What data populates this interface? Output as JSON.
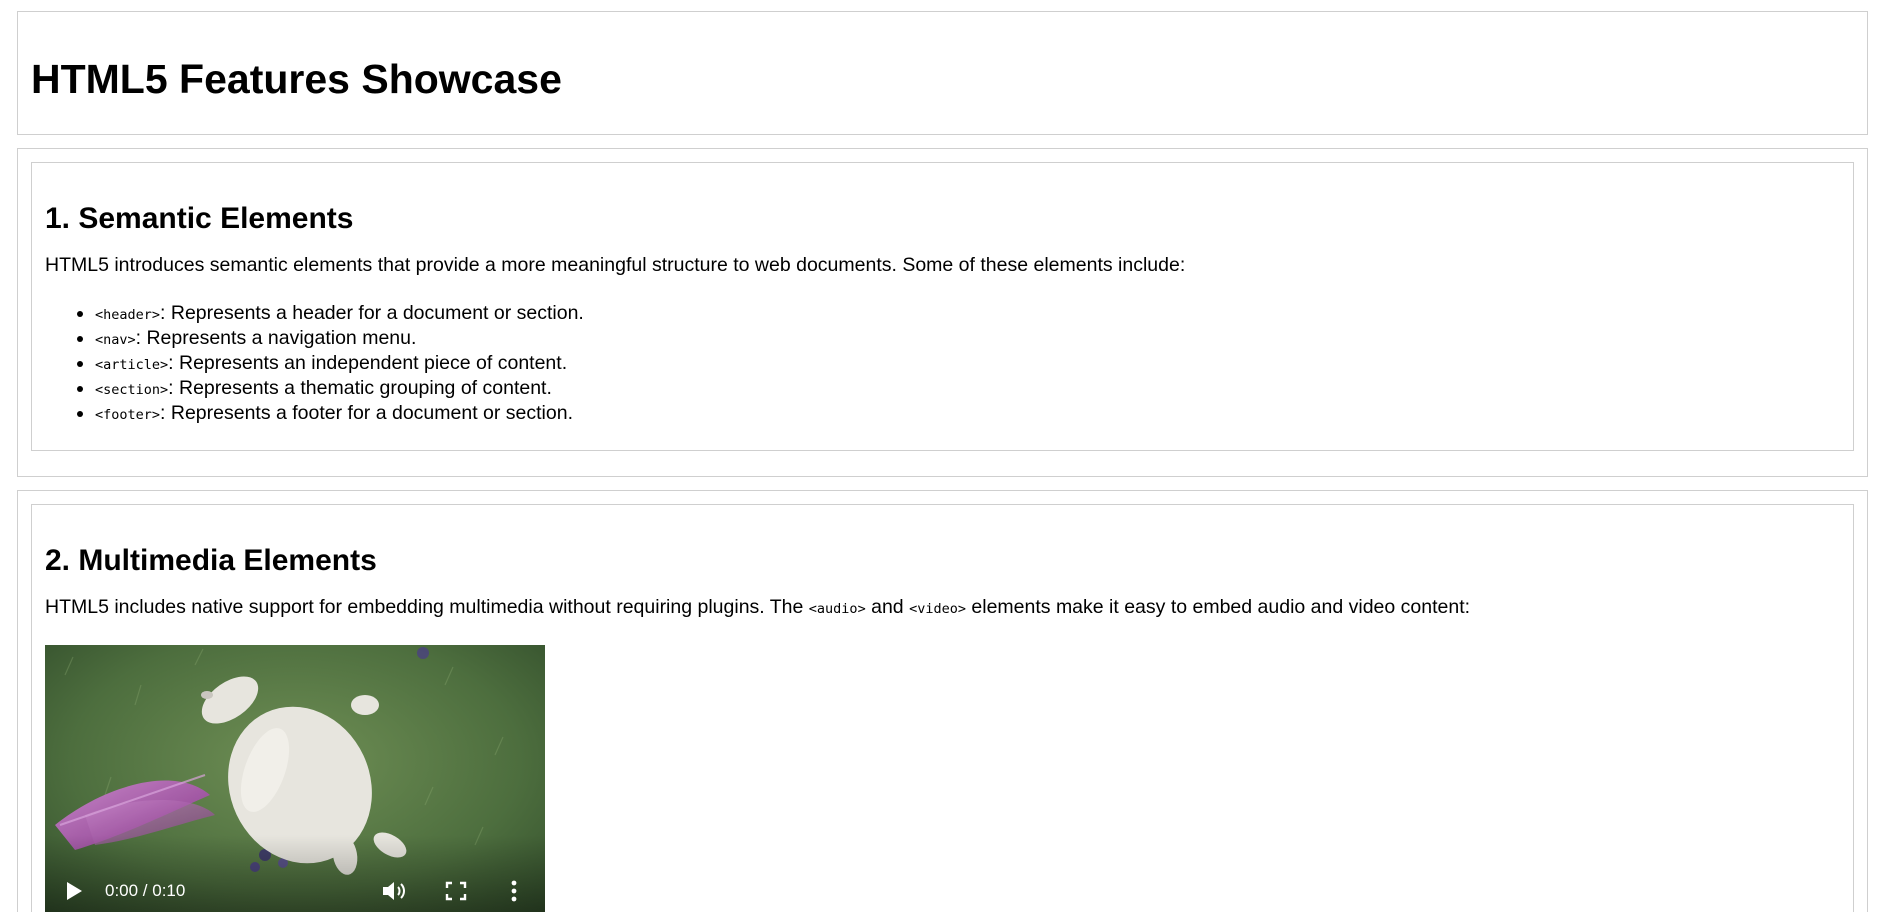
{
  "header": {
    "title": "HTML5 Features Showcase"
  },
  "semantic": {
    "title": "1. Semantic Elements",
    "intro": "HTML5 introduces semantic elements that provide a more meaningful structure to web documents. Some of these elements include:",
    "items": [
      {
        "tag": "<header>",
        "desc": ": Represents a header for a document or section."
      },
      {
        "tag": "<nav>",
        "desc": ": Represents a navigation menu."
      },
      {
        "tag": "<article>",
        "desc": ": Represents an independent piece of content."
      },
      {
        "tag": "<section>",
        "desc": ": Represents a thematic grouping of content."
      },
      {
        "tag": "<footer>",
        "desc": ": Represents a footer for a document or section."
      }
    ]
  },
  "multimedia": {
    "title": "2. Multimedia Elements",
    "intro_before": "HTML5 includes native support for embedding multimedia without requiring plugins. The ",
    "code_audio": "<audio>",
    "intro_mid": " and ",
    "code_video": "<video>",
    "intro_after": " elements make it easy to embed audio and video content:",
    "video": {
      "time": "0:00 / 0:10",
      "buffered_fraction": 0.55,
      "icons": [
        "play-icon",
        "volume-icon",
        "fullscreen-icon",
        "more-options-icon"
      ]
    }
  }
}
